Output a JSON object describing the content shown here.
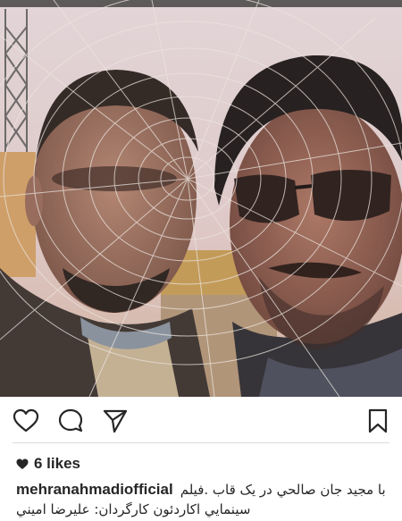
{
  "post": {
    "likes_label": "6 likes",
    "username": "mehranahmadiofficial",
    "caption_line1": "با مجيد جان صالحي در يک قاب .فيلم",
    "caption_line2": "سينمايي اکاردئون کارگردان: عليرضا اميني"
  },
  "icons": {
    "like": "heart-outline-icon",
    "comment": "comment-bubble-icon",
    "share": "paper-plane-icon",
    "save": "bookmark-icon",
    "likes_heart": "heart-filled-icon"
  },
  "colors": {
    "text": "#262626",
    "divider": "#dbdbdb",
    "sky": "#e8d6d8"
  }
}
